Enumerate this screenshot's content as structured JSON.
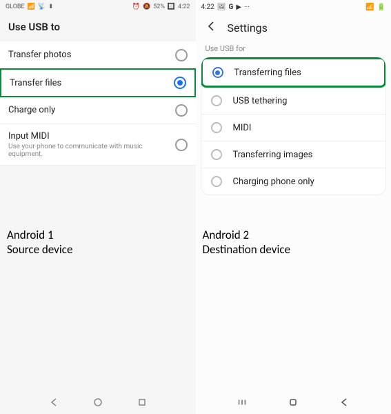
{
  "left": {
    "statusbar": {
      "carrier": "GLOBE",
      "icons": "📶📡↕",
      "right": "⏰🔕52% 🔲 4:22"
    },
    "title": "Use USB to",
    "items": [
      {
        "label": "Transfer photos",
        "sub": "",
        "selected": false,
        "highlight": false
      },
      {
        "label": "Transfer files",
        "sub": "",
        "selected": true,
        "highlight": true
      },
      {
        "label": "Charge only",
        "sub": "",
        "selected": false,
        "highlight": false
      },
      {
        "label": "Input MIDI",
        "sub": "Use your phone to communicate with music equipment.",
        "selected": false,
        "highlight": false
      }
    ],
    "caption1": "Android 1",
    "caption2": "Source device"
  },
  "right": {
    "statusbar": {
      "left": "4:22 🖼 G ▶ ···",
      "right": "📶🔋"
    },
    "title": "Settings",
    "section": "Use USB for",
    "items": [
      {
        "label": "Transferring files",
        "selected": true,
        "highlight": true
      },
      {
        "label": "USB tethering",
        "selected": false,
        "highlight": false
      },
      {
        "label": "MIDI",
        "selected": false,
        "highlight": false
      },
      {
        "label": "Transferring images",
        "selected": false,
        "highlight": false
      },
      {
        "label": "Charging phone only",
        "selected": false,
        "highlight": false
      }
    ],
    "caption1": "Android 2",
    "caption2": "Destination device"
  }
}
